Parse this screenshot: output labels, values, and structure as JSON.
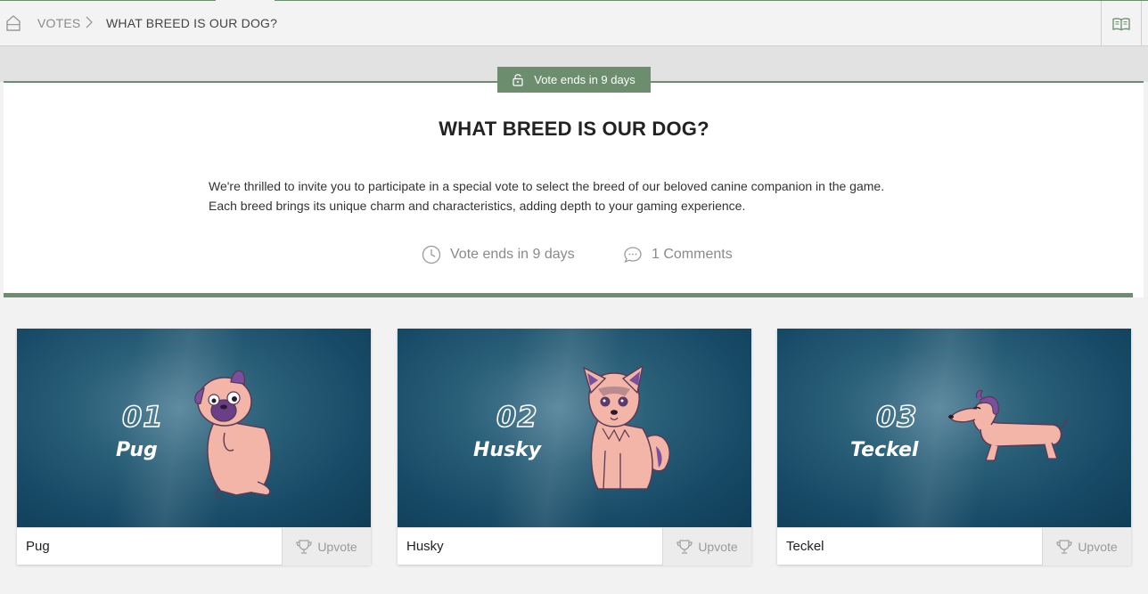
{
  "breadcrumb": {
    "section": "VOTES",
    "current": "WHAT BREED IS OUR DOG?"
  },
  "header": {
    "status_badge": "Vote ends in 9 days",
    "title": "WHAT BREED IS OUR DOG?",
    "description_line1": "We're thrilled to invite you to participate in a special vote to select the breed of our beloved canine companion in the game.",
    "description_line2": "Each breed brings its unique charm and characteristics, adding depth to your gaming experience.",
    "time_left": "Vote ends in 9 days",
    "comments": "1 Comments"
  },
  "icons": {
    "home": "home-icon",
    "separator": "chevron-right-icon",
    "guide": "book-icon",
    "lock": "unlock-icon",
    "clock": "clock-icon",
    "comment": "comment-icon",
    "upvote": "trophy-icon"
  },
  "colors": {
    "accent": "#6c8d6e",
    "banner": "#174a66",
    "dog_body": "#f2b5a7",
    "dog_accent": "#7a4f9e"
  },
  "options": [
    {
      "number": "01",
      "banner_name": "Pug",
      "name": "Pug",
      "upvote_label": "Upvote"
    },
    {
      "number": "02",
      "banner_name": "Husky",
      "name": "Husky",
      "upvote_label": "Upvote"
    },
    {
      "number": "03",
      "banner_name": "Teckel",
      "name": "Teckel",
      "upvote_label": "Upvote"
    }
  ]
}
